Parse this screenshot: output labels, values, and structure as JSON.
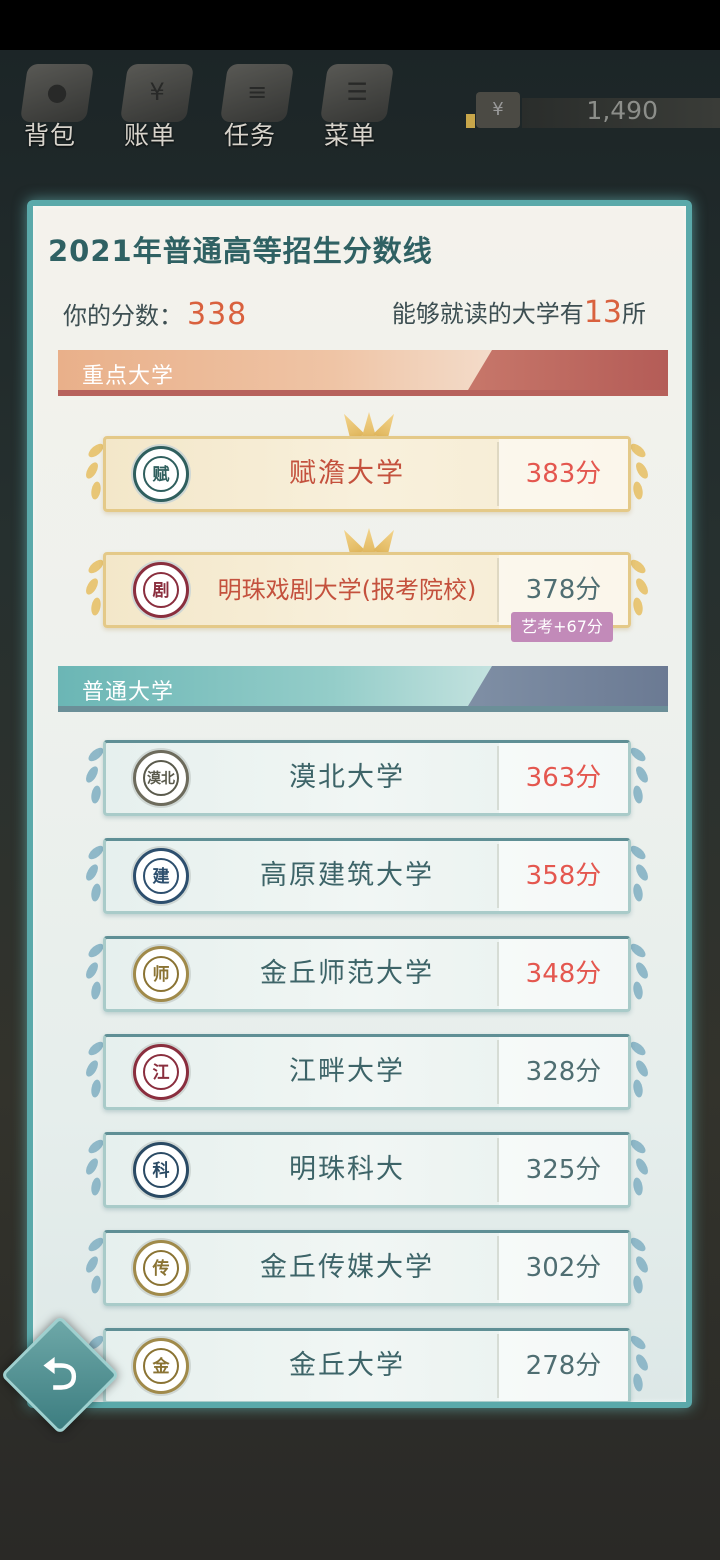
{
  "topbar": {
    "nav": [
      {
        "label": "背包",
        "icon": "bag-icon"
      },
      {
        "label": "账单",
        "icon": "bill-icon"
      },
      {
        "label": "任务",
        "icon": "task-icon"
      },
      {
        "label": "菜单",
        "icon": "menu-icon"
      }
    ],
    "money_symbol": "¥",
    "money_value": "1,490"
  },
  "panel": {
    "title": "2021年普通高等招生分数线",
    "score_label": "你的分数：",
    "score_value": "338",
    "count_prefix": "能够就读的大学有",
    "count_value": "13",
    "count_suffix": "所"
  },
  "sections": {
    "key": {
      "label": "重点大学"
    },
    "normal": {
      "label": "普通大学"
    }
  },
  "key_universities": [
    {
      "name": "赋澹大学",
      "score": "383分",
      "logo_text": "赋",
      "score_color": "red"
    },
    {
      "name": "明珠戏剧大学(报考院校)",
      "score": "378分",
      "logo_text": "剧",
      "score_color": "gray",
      "badge": "艺考+67分"
    }
  ],
  "normal_universities": [
    {
      "name": "漠北大学",
      "score": "363分",
      "logo_text": "漠北",
      "score_color": "red"
    },
    {
      "name": "高原建筑大学",
      "score": "358分",
      "logo_text": "建",
      "score_color": "red"
    },
    {
      "name": "金丘师范大学",
      "score": "348分",
      "logo_text": "师",
      "score_color": "red"
    },
    {
      "name": "江畔大学",
      "score": "328分",
      "logo_text": "江",
      "score_color": "gray"
    },
    {
      "name": "明珠科大",
      "score": "325分",
      "logo_text": "科",
      "score_color": "gray"
    },
    {
      "name": "金丘传媒大学",
      "score": "302分",
      "logo_text": "传",
      "score_color": "gray"
    },
    {
      "name": "金丘大学",
      "score": "278分",
      "logo_text": "金",
      "score_color": "gray"
    }
  ],
  "colors": {
    "panel_border": "#5aa9aa",
    "title": "#2f6163",
    "score_red": "#e4574f",
    "key_accent": "#b7625c",
    "normal_accent": "#6b8f98",
    "art_badge": "#c28ab9"
  },
  "back_button": {
    "icon": "back-arrow-icon"
  }
}
